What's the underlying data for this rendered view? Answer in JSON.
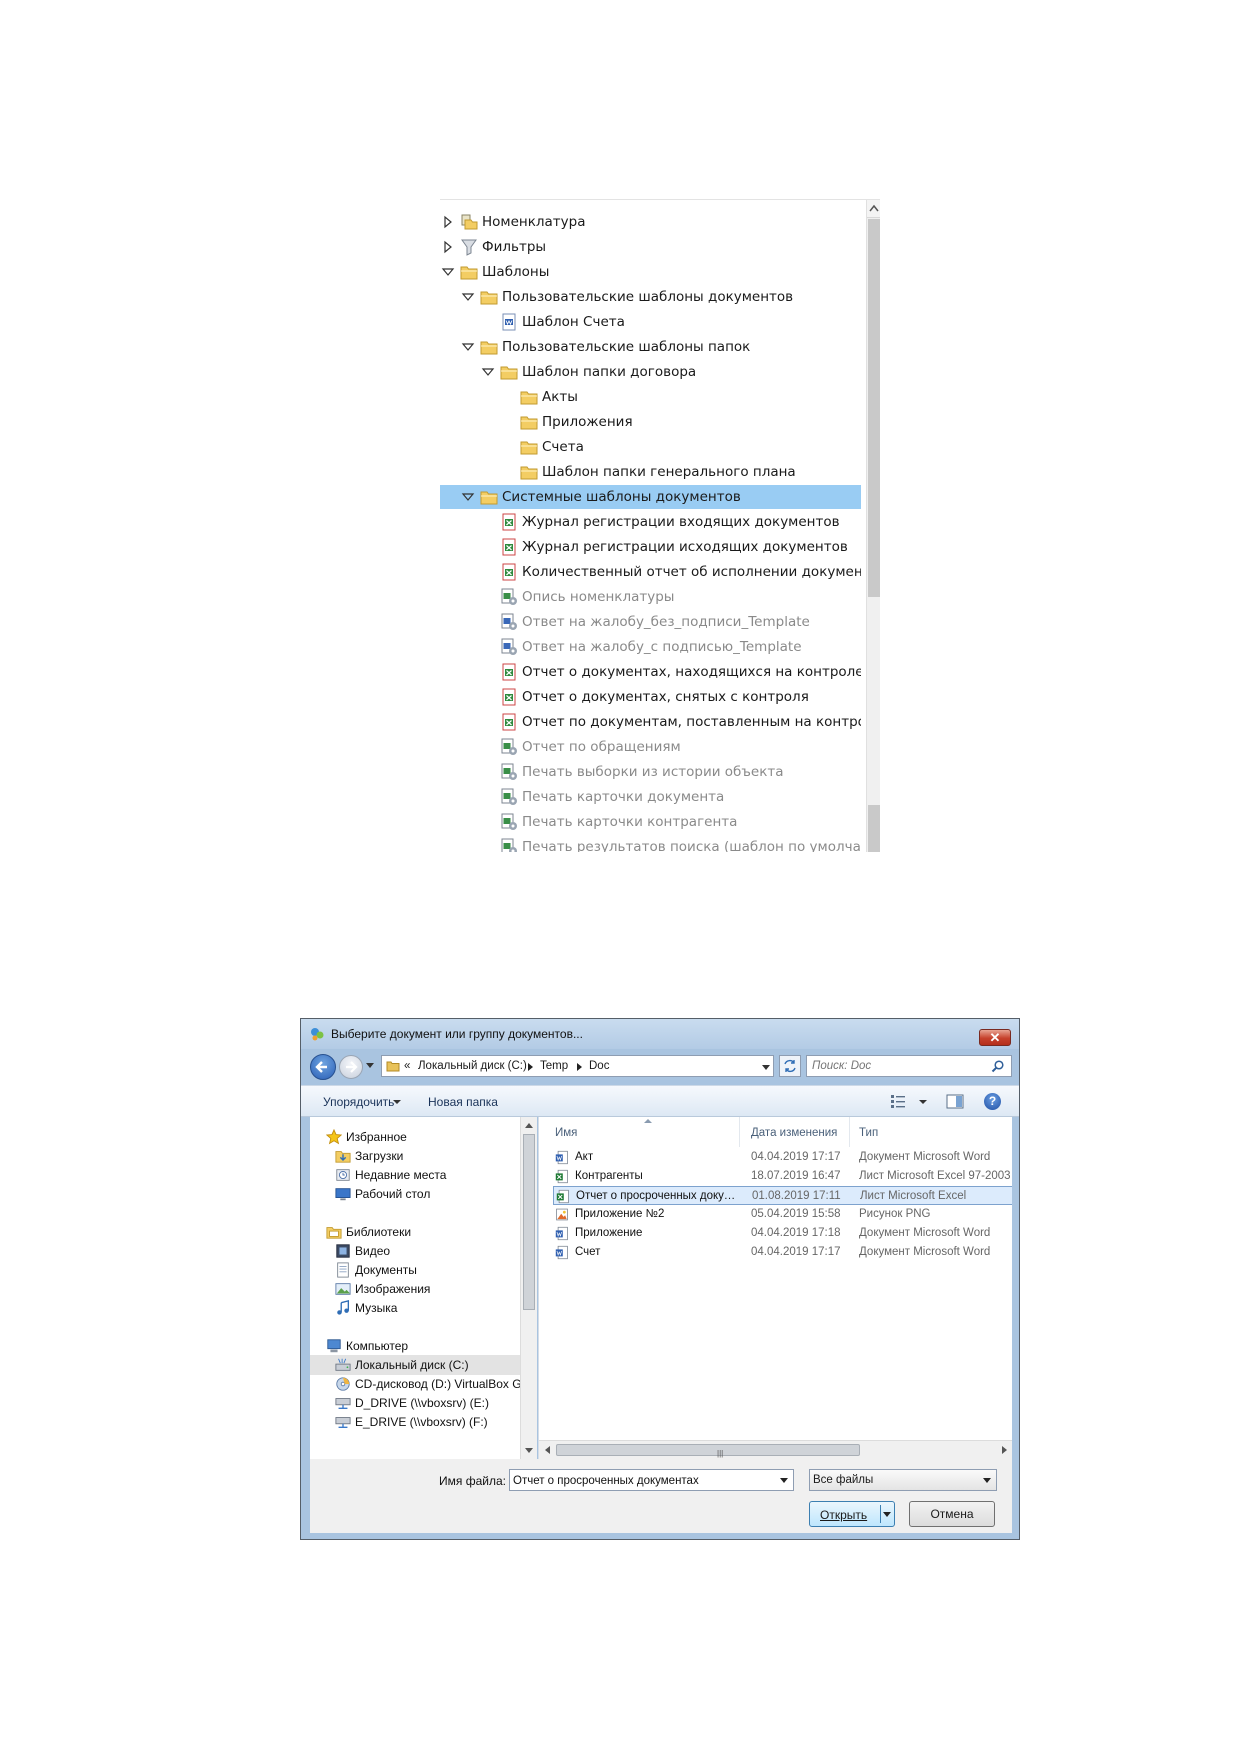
{
  "tree": {
    "rows": [
      {
        "label": "Номенклатура",
        "level": 0,
        "expander": "collapsed",
        "icon": "nomenclature-icon",
        "muted": false
      },
      {
        "label": "Фильтры",
        "level": 0,
        "expander": "collapsed",
        "icon": "filter-icon",
        "muted": false
      },
      {
        "label": "Шаблоны",
        "level": 0,
        "expander": "expanded",
        "icon": "folder-icon",
        "muted": false
      },
      {
        "label": "Пользовательские шаблоны документов",
        "level": 1,
        "expander": "expanded",
        "icon": "folder-icon",
        "muted": false
      },
      {
        "label": "Шаблон Счета",
        "level": 2,
        "expander": "none",
        "icon": "word-template-icon",
        "muted": false
      },
      {
        "label": "Пользовательские шаблоны папок",
        "level": 1,
        "expander": "expanded",
        "icon": "folder-icon",
        "muted": false
      },
      {
        "label": "Шаблон папки договора",
        "level": 2,
        "expander": "expanded",
        "icon": "folder-icon",
        "muted": false
      },
      {
        "label": "Акты",
        "level": 3,
        "expander": "none",
        "icon": "folder-icon",
        "muted": false
      },
      {
        "label": "Приложения",
        "level": 3,
        "expander": "none",
        "icon": "folder-icon",
        "muted": false
      },
      {
        "label": "Счета",
        "level": 3,
        "expander": "none",
        "icon": "folder-icon",
        "muted": false
      },
      {
        "label": "Шаблон папки генерального плана",
        "level": 3,
        "expander": "none",
        "icon": "folder-icon",
        "muted": false
      },
      {
        "label": "Системные шаблоны документов",
        "level": 1,
        "expander": "expanded",
        "icon": "folder-icon",
        "muted": false,
        "selected": true
      },
      {
        "label": "Журнал регистрации входящих документов",
        "level": 2,
        "expander": "none",
        "icon": "excel-template-icon",
        "muted": false
      },
      {
        "label": "Журнал регистрации исходящих документов",
        "level": 2,
        "expander": "none",
        "icon": "excel-template-icon",
        "muted": false
      },
      {
        "label": "Количественный отчет об исполнении документов",
        "level": 2,
        "expander": "none",
        "icon": "excel-template-icon",
        "muted": false
      },
      {
        "label": "Опись номенклатуры",
        "level": 2,
        "expander": "none",
        "icon": "excel-system-icon",
        "muted": true
      },
      {
        "label": "Ответ на жалобу_без_подписи_Template",
        "level": 2,
        "expander": "none",
        "icon": "word-system-icon",
        "muted": true
      },
      {
        "label": "Ответ на жалобу_с подписью_Template",
        "level": 2,
        "expander": "none",
        "icon": "word-system-icon",
        "muted": true
      },
      {
        "label": "Отчет о документах, находящихся на контроле на",
        "level": 2,
        "expander": "none",
        "icon": "excel-template-icon",
        "muted": false
      },
      {
        "label": "Отчет о документах, снятых с контроля",
        "level": 2,
        "expander": "none",
        "icon": "excel-template-icon",
        "muted": false
      },
      {
        "label": "Отчет по документам, поставленным на контроль",
        "level": 2,
        "expander": "none",
        "icon": "excel-template-icon",
        "muted": false
      },
      {
        "label": "Отчет по обращениям",
        "level": 2,
        "expander": "none",
        "icon": "excel-system-icon",
        "muted": true
      },
      {
        "label": "Печать выборки из истории объекта",
        "level": 2,
        "expander": "none",
        "icon": "excel-system-icon",
        "muted": true
      },
      {
        "label": "Печать карточки документа",
        "level": 2,
        "expander": "none",
        "icon": "excel-system-icon",
        "muted": true
      },
      {
        "label": "Печать карточки контрагента",
        "level": 2,
        "expander": "none",
        "icon": "excel-system-icon",
        "muted": true
      },
      {
        "label": "Печать результатов поиска (шаблон по умолчанию",
        "level": 2,
        "expander": "none",
        "icon": "excel-system-icon",
        "muted": true
      }
    ]
  },
  "dialog": {
    "title": "Выберите документ или группу документов...",
    "close_label": "✕",
    "address": {
      "chevron": "«",
      "segments": [
        "Локальный диск (C:)",
        "Temp",
        "Doc"
      ]
    },
    "search_placeholder": "Поиск: Doc",
    "toolbar": {
      "organize": "Упорядочить",
      "new_folder": "Новая папка",
      "help": "?"
    },
    "nav": [
      {
        "label": "Избранное",
        "icon": "favorites-star-icon",
        "indent": 0
      },
      {
        "label": "Загрузки",
        "icon": "downloads-icon",
        "indent": 1
      },
      {
        "label": "Недавние места",
        "icon": "recent-places-icon",
        "indent": 1
      },
      {
        "label": "Рабочий стол",
        "icon": "desktop-icon",
        "indent": 1
      },
      {
        "label": "Библиотеки",
        "icon": "libraries-icon",
        "indent": 0
      },
      {
        "label": "Видео",
        "icon": "video-icon",
        "indent": 1
      },
      {
        "label": "Документы",
        "icon": "documents-icon",
        "indent": 1
      },
      {
        "label": "Изображения",
        "icon": "pictures-icon",
        "indent": 1
      },
      {
        "label": "Музыка",
        "icon": "music-icon",
        "indent": 1
      },
      {
        "label": "Компьютер",
        "icon": "computer-icon",
        "indent": 0
      },
      {
        "label": "Локальный диск (C:)",
        "icon": "local-disk-icon",
        "indent": 1,
        "selected": true
      },
      {
        "label": "CD-дисковод (D:) VirtualBox Guest Additions",
        "icon": "cd-drive-icon",
        "indent": 1
      },
      {
        "label": "D_DRIVE (\\\\vboxsrv) (E:)",
        "icon": "network-drive-icon",
        "indent": 1
      },
      {
        "label": "E_DRIVE (\\\\vboxsrv) (F:)",
        "icon": "network-drive-icon",
        "indent": 1
      }
    ],
    "columns": {
      "name": "Имя",
      "date": "Дата изменения",
      "type": "Тип"
    },
    "files": [
      {
        "name": "Акт",
        "date": "04.04.2019 17:17",
        "type": "Документ Microsoft Word",
        "icon": "word-doc-icon"
      },
      {
        "name": "Контрагенты",
        "date": "18.07.2019 16:47",
        "type": "Лист Microsoft Excel 97-2003",
        "icon": "excel-doc-icon"
      },
      {
        "name": "Отчет о просроченных документах",
        "date": "01.08.2019 17:11",
        "type": "Лист Microsoft Excel",
        "icon": "excel-doc-icon",
        "selected": true
      },
      {
        "name": "Приложение №2",
        "date": "05.04.2019 15:58",
        "type": "Рисунок PNG",
        "icon": "png-image-icon"
      },
      {
        "name": "Приложение",
        "date": "04.04.2019 17:18",
        "type": "Документ Microsoft Word",
        "icon": "word-doc-icon"
      },
      {
        "name": "Счет",
        "date": "04.04.2019 17:17",
        "type": "Документ Microsoft Word",
        "icon": "word-doc-icon"
      }
    ],
    "filename_label": "Имя файла:",
    "filename_value": "Отчет о просроченных документах",
    "filter_value": "Все файлы",
    "open_label": "Открыть",
    "cancel_label": "Отмена"
  },
  "colors": {
    "selection": "#99ccf3",
    "list_selection": "#dcebfc",
    "dialog_frame": "#a9c4e0",
    "close_button": "#c6412c"
  }
}
